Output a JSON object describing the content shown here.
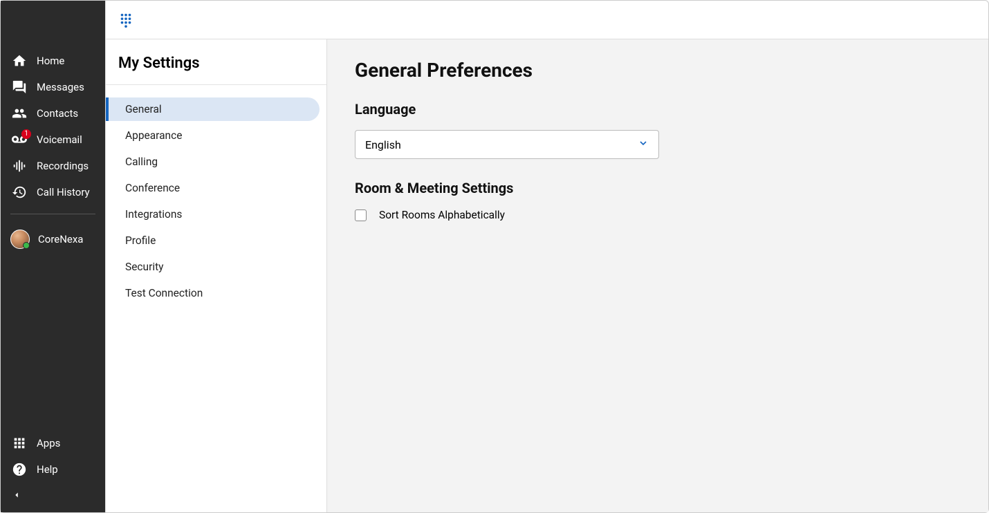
{
  "leftnav": {
    "items": [
      {
        "label": "Home"
      },
      {
        "label": "Messages"
      },
      {
        "label": "Contacts"
      },
      {
        "label": "Voicemail",
        "badge": "1"
      },
      {
        "label": "Recordings"
      },
      {
        "label": "Call History"
      }
    ],
    "user_name": "CoreNexa",
    "bottom": [
      {
        "label": "Apps"
      },
      {
        "label": "Help"
      }
    ]
  },
  "settings": {
    "title": "My Settings",
    "items": [
      {
        "label": "General",
        "active": true
      },
      {
        "label": "Appearance"
      },
      {
        "label": "Calling"
      },
      {
        "label": "Conference"
      },
      {
        "label": "Integrations"
      },
      {
        "label": "Profile"
      },
      {
        "label": "Security"
      },
      {
        "label": "Test Connection"
      }
    ]
  },
  "panel": {
    "title": "General Preferences",
    "language_label": "Language",
    "language_value": "English",
    "room_label": "Room & Meeting Settings",
    "sort_rooms_label": "Sort Rooms Alphabetically"
  }
}
